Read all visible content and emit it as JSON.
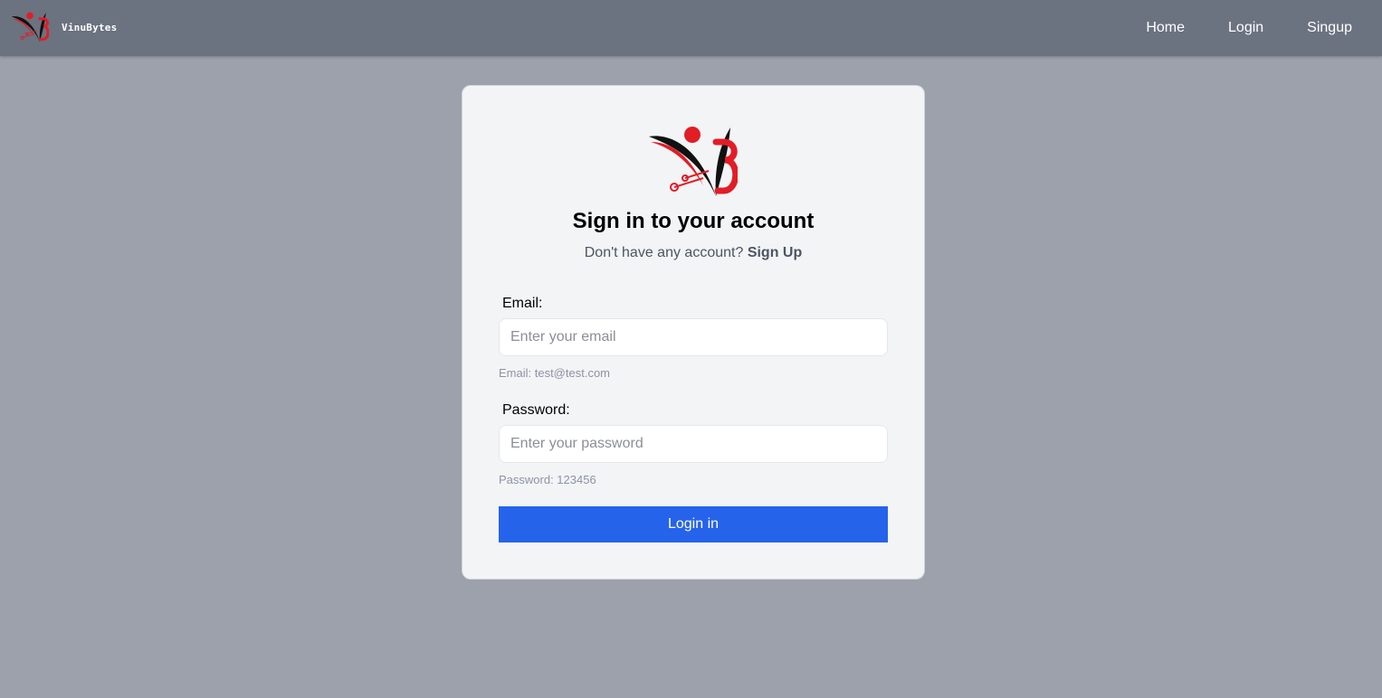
{
  "navbar": {
    "brand_name": "VinuBytes",
    "logo_icon": "vinubytes-logo-icon",
    "links": [
      "Home",
      "Login",
      "Singup"
    ]
  },
  "login_card": {
    "logo_icon": "vinubytes-logo-icon",
    "title": "Sign in to your account",
    "subtitle_text": "Don't have any account?",
    "signup_link": "Sign Up",
    "email": {
      "label": "Email:",
      "placeholder": "Enter your email",
      "value": "",
      "hint": "Email: test@test.com"
    },
    "password": {
      "label": "Password:",
      "placeholder": "Enter your password",
      "value": "",
      "hint": "Password: 123456"
    },
    "submit_label": "Login in"
  },
  "colors": {
    "page_background": "#9ca1ac",
    "navbar": "#6b7280",
    "card": "#f3f4f6",
    "primary_button": "#2563eb",
    "logo_red": "#e11d26",
    "logo_black": "#111111"
  }
}
